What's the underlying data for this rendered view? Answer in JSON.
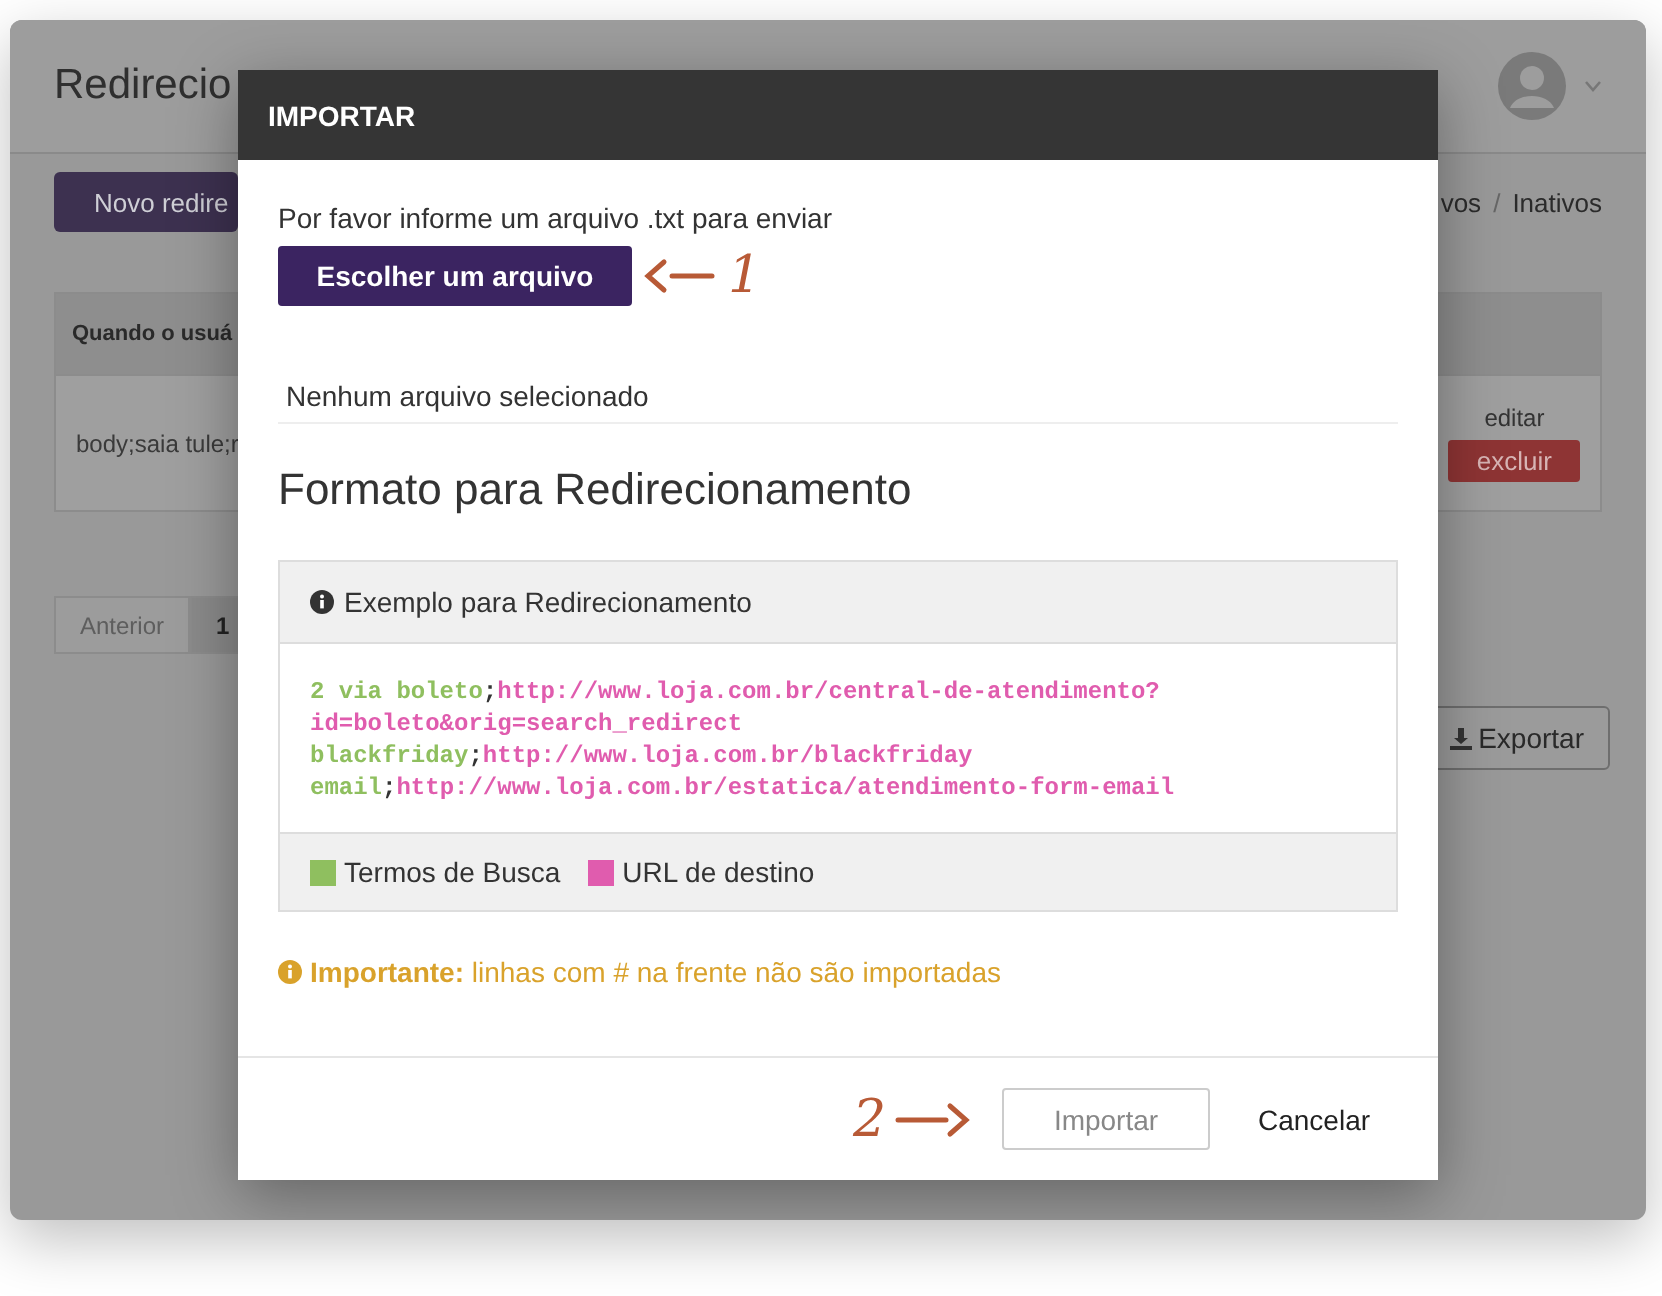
{
  "page": {
    "title": "Redirecio",
    "new_button": "Novo redire",
    "filters": [
      {
        "label": "vos",
        "selected": false
      },
      {
        "label": "Inativos",
        "selected": false
      }
    ],
    "filter_separator": "/",
    "table": {
      "header": "Quando o usuá",
      "row": {
        "text": "body;saia tule;r",
        "edit": "editar",
        "delete": "excluir"
      }
    },
    "pagination": [
      {
        "label": "Anterior",
        "disabled": true,
        "selected": false
      },
      {
        "label": "1",
        "disabled": false,
        "selected": true
      }
    ],
    "export_button": "Exportar"
  },
  "dialog": {
    "title": "IMPORTAR",
    "prompt": "Por favor informe um arquivo .txt para enviar",
    "choose_button": "Escolher um arquivo",
    "file_status": "Nenhum arquivo selecionado",
    "heading": "Formato para Redirecionamento",
    "example": {
      "title": "Exemplo para Redirecionamento",
      "lines": [
        [
          {
            "kind": "term",
            "text": "2 via boleto"
          },
          {
            "kind": "sep",
            "text": ";"
          },
          {
            "kind": "url",
            "text": "http://www.loja.com.br/central-de-atendimento?"
          }
        ],
        [
          {
            "kind": "url",
            "text": "id=boleto&orig=search_redirect"
          }
        ],
        [
          {
            "kind": "term",
            "text": "blackfriday"
          },
          {
            "kind": "sep",
            "text": ";"
          },
          {
            "kind": "url",
            "text": "http://www.loja.com.br/blackfriday"
          }
        ],
        [
          {
            "kind": "term",
            "text": "email"
          },
          {
            "kind": "sep",
            "text": ";"
          },
          {
            "kind": "url",
            "text": "http://www.loja.com.br/estatica/atendimento-form-email"
          }
        ]
      ],
      "legend": [
        {
          "label": "Termos de Busca",
          "color": "#8fbf5f"
        },
        {
          "label": "URL de destino",
          "color": "#e05cae"
        }
      ]
    },
    "note": "**Importante:** linhas com # na frente não são importadas",
    "buttons": [
      {
        "label": "Importar",
        "kind": "outline",
        "disabled": true
      },
      {
        "label": "Cancelar",
        "kind": "plain",
        "disabled": false
      }
    ],
    "annotations": [
      {
        "label": "1"
      },
      {
        "label": "2"
      }
    ]
  }
}
